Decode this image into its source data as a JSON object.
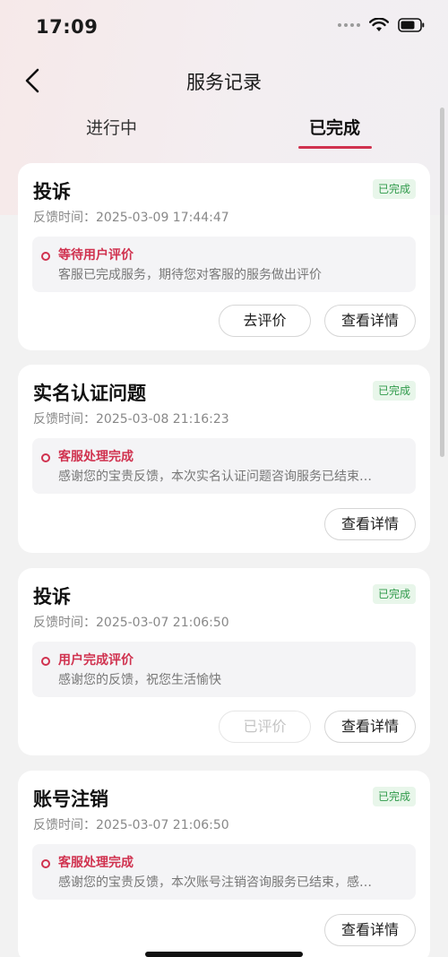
{
  "status_bar": {
    "time": "17:09",
    "icons": [
      "signal-dots-icon",
      "wifi-icon",
      "battery-icon"
    ]
  },
  "nav": {
    "back_icon": "chevron-left-icon",
    "title": "服务记录"
  },
  "tabs": [
    {
      "label": "进行中",
      "active": false
    },
    {
      "label": "已完成",
      "active": true
    }
  ],
  "colors": {
    "accent": "#d0324f",
    "badge_bg": "#e8f6ea",
    "badge_text": "#2f9a4a"
  },
  "records": [
    {
      "title": "投诉",
      "badge": "已完成",
      "meta_label": "反馈时间：",
      "meta_value": "2025-03-09 17:44:47",
      "status": "等待用户评价",
      "desc": "客服已完成服务，期待您对客服的服务做出评价",
      "review_button": "去评价",
      "detail_button": "查看详情"
    },
    {
      "title": "实名认证问题",
      "badge": "已完成",
      "meta_label": "反馈时间：",
      "meta_value": "2025-03-08 21:16:23",
      "status": "客服处理完成",
      "desc": "感谢您的宝贵反馈，本次实名认证问题咨询服务已结束…",
      "detail_button": "查看详情"
    },
    {
      "title": "投诉",
      "badge": "已完成",
      "meta_label": "反馈时间：",
      "meta_value": "2025-03-07 21:06:50",
      "status": "用户完成评价",
      "desc": "感谢您的反馈，祝您生活愉快",
      "reviewed_button": "已评价",
      "detail_button": "查看详情"
    },
    {
      "title": "账号注销",
      "badge": "已完成",
      "meta_label": "反馈时间：",
      "meta_value": "2025-03-07 21:06:50",
      "status": "客服处理完成",
      "desc": "感谢您的宝贵反馈，本次账号注销咨询服务已结束，感…",
      "detail_button": "查看详情"
    }
  ]
}
